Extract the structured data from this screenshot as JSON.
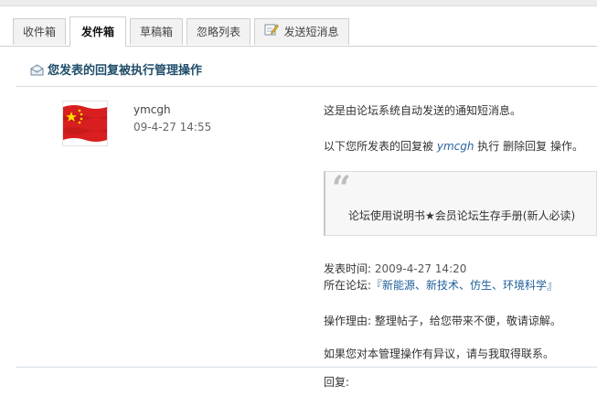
{
  "tabs": {
    "inbox": "收件箱",
    "sent": "发件箱",
    "drafts": "草稿箱",
    "ignore": "忽略列表",
    "send_pm": "发送短消息"
  },
  "thread": {
    "title": "您发表的回复被执行管理操作"
  },
  "author": {
    "name": "ymcgh",
    "time": "09-4-27 14:55"
  },
  "message": {
    "intro": "这是由论坛系统自动发送的通知短消息。",
    "action_prefix": "以下您所发表的回复被",
    "actor": "ymcgh",
    "action_middle": "执行",
    "action_name": "删除回复",
    "action_suffix": "操作。",
    "quote": "论坛使用说明书★会员论坛生存手册(新人必读)",
    "post_time_label": "发表时间:",
    "post_time_value": "2009-4-27 14:20",
    "forum_label": "所在论坛:",
    "forum_value": "『新能源、新技术、仿生、环境科学』",
    "reason_label": "操作理由:",
    "reason_value": "整理帖子，给您带来不便，敬请谅解。",
    "contact": "如果您对本管理操作有异议，请与我取得联系。"
  },
  "reply": {
    "label": "回复:"
  }
}
